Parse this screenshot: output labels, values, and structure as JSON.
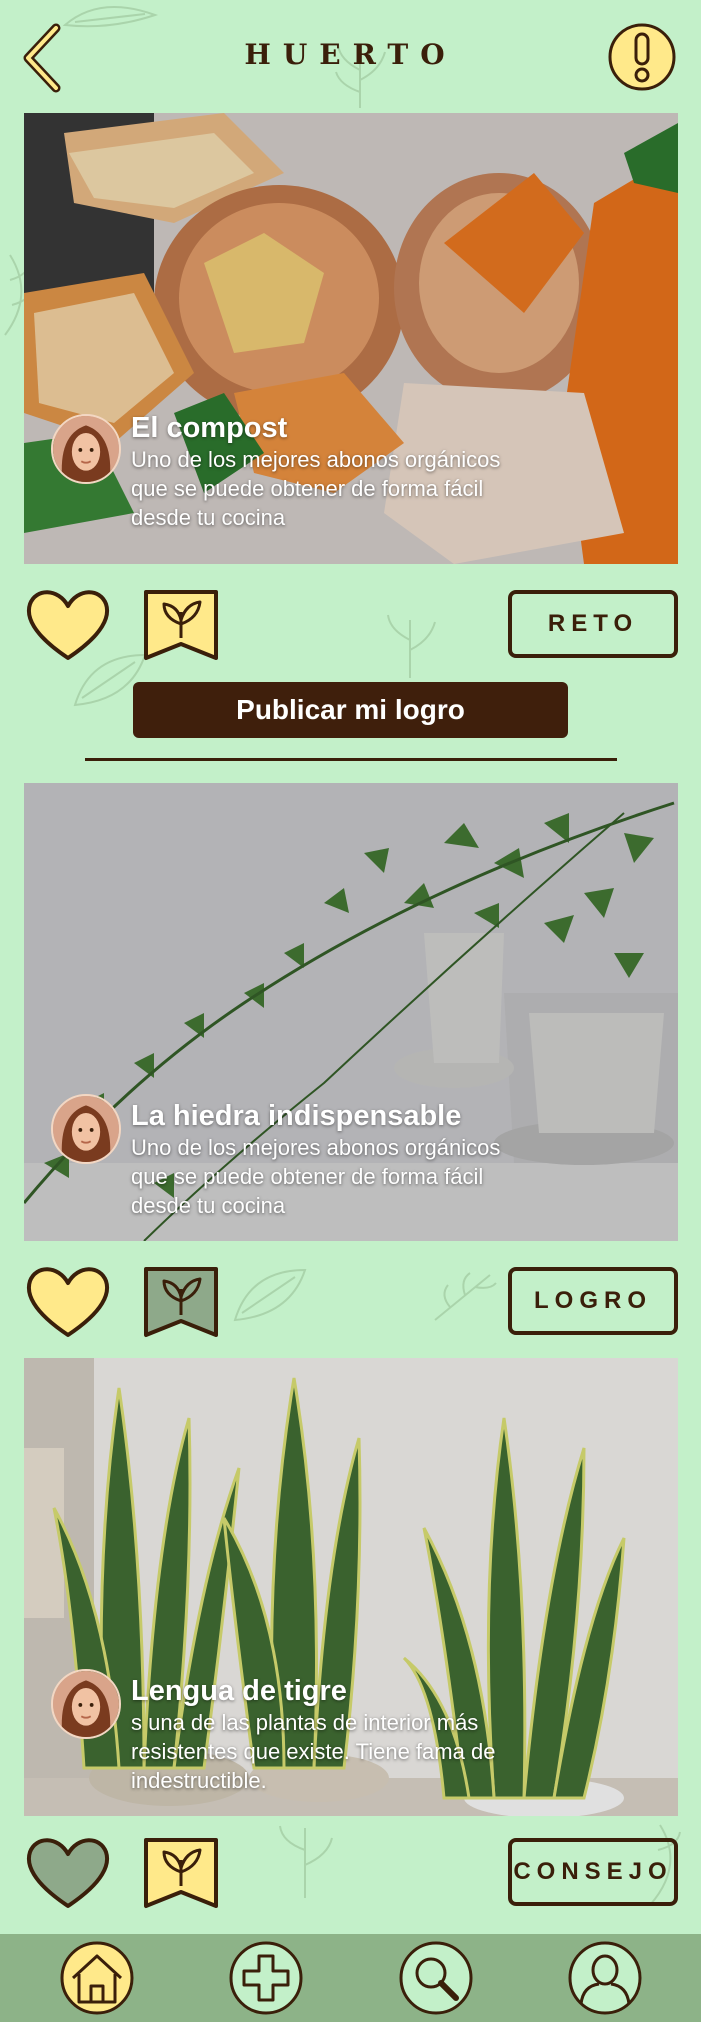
{
  "header": {
    "title": "HUERTO",
    "back_icon": "chevron-left-icon",
    "alert_icon": "exclamation-icon"
  },
  "colors": {
    "background": "#c3f0c9",
    "accent_yellow": "#ffe98a",
    "dark_brown": "#3f1f0c",
    "nav_bar": "#8db388",
    "liked_gray_green": "#8ea98a"
  },
  "posts": [
    {
      "title": "El compost",
      "description": [
        "Uno de los mejores abonos orgánicos",
        "que se puede obtener de forma fácil",
        "desde tu cocina"
      ],
      "tag": "RETO",
      "heart_filled": "yellow",
      "badge_filled": "yellow"
    },
    {
      "title": "La hiedra indispensable",
      "description": [
        "Uno de los mejores abonos orgánicos",
        "que se puede obtener de forma fácil",
        "desde tu cocina"
      ],
      "tag": "LOGRO",
      "heart_filled": "yellow",
      "badge_filled": "green"
    },
    {
      "title": "Lengua de tigre",
      "description": [
        "s una de las plantas de interior más",
        "resistentes que existe. Tiene fama de",
        "indestructible."
      ],
      "tag": "CONSEJO",
      "heart_filled": "green",
      "badge_filled": "yellow"
    }
  ],
  "publish_button": "Publicar mi logro",
  "bottom_nav": [
    {
      "icon": "home-icon",
      "active": true
    },
    {
      "icon": "plus-icon",
      "active": false
    },
    {
      "icon": "search-icon",
      "active": false
    },
    {
      "icon": "profile-icon",
      "active": false
    }
  ]
}
